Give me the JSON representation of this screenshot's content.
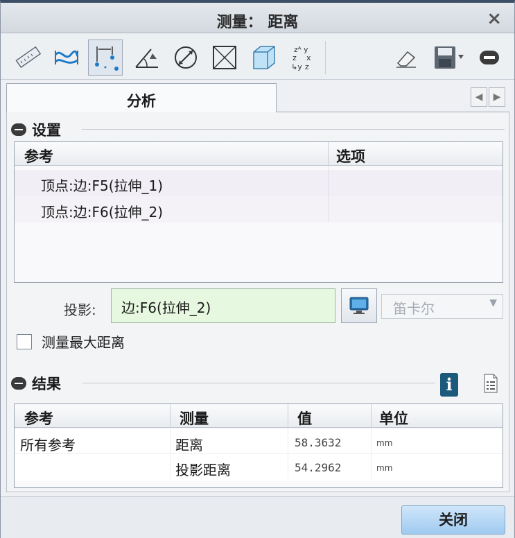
{
  "window": {
    "title": "测量： 距离",
    "close_glyph": "×"
  },
  "toolbar": {
    "tools": [
      {
        "icon": "ruler-length-icon"
      },
      {
        "icon": "curve-wave-icon"
      },
      {
        "icon": "distance-icon",
        "active": true
      },
      {
        "icon": "angle-icon"
      },
      {
        "icon": "diameter-icon"
      },
      {
        "icon": "area-icon"
      },
      {
        "icon": "volume-cube-icon"
      },
      {
        "icon": "transform-xyz-icon"
      }
    ],
    "right_tools": [
      {
        "icon": "eraser-icon"
      },
      {
        "icon": "save-icon"
      },
      {
        "icon": "collapse-minus-icon"
      }
    ]
  },
  "tabs": {
    "active_label": "分析"
  },
  "settings": {
    "title": "设置",
    "columns": [
      "参考",
      "选项"
    ],
    "rows": [
      {
        "ref": "顶点:边:F5(拉伸_1)",
        "option": ""
      },
      {
        "ref": "顶点:边:F6(拉伸_2)",
        "option": ""
      }
    ],
    "projection_label": "投影:",
    "projection_value": "边:F6(拉伸_2)",
    "coordinate_system": "笛卡尔",
    "max_distance_label": "测量最大距离",
    "max_distance_checked": false
  },
  "results": {
    "title": "结果",
    "columns": [
      "参考",
      "测量",
      "值",
      "单位"
    ],
    "rows": [
      {
        "ref": "所有参考",
        "measure": "距离",
        "value": "58.3632",
        "unit": "mm"
      },
      {
        "ref": "",
        "measure": "投影距离",
        "value": "54.2962",
        "unit": "mm"
      }
    ],
    "info_glyph": "i"
  },
  "footer": {
    "close_label": "关闭"
  },
  "colors": {
    "accent": "#1b5a7a",
    "projection_bg": "#e6f8df",
    "close_button": "#9fcaf0"
  }
}
